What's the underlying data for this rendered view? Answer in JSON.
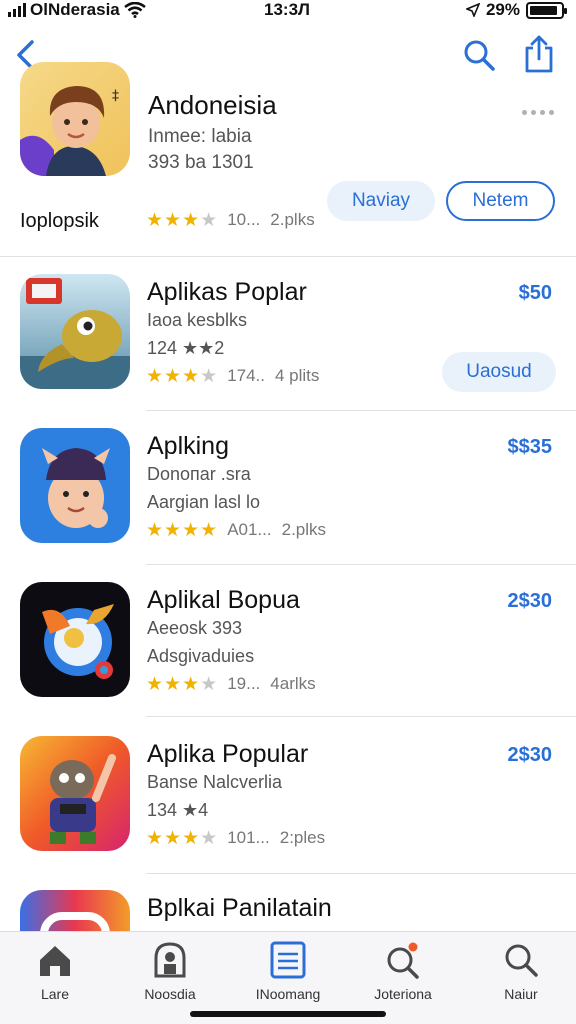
{
  "status": {
    "carrier": "OlNderasia",
    "time": "13:3Л",
    "battery": "29%",
    "battery_level": 0.9
  },
  "hero": {
    "title": "Andoneisia",
    "subtitle1": "Inmee: labia",
    "subtitle2": "393 ba 1301",
    "tag": "Ioplopsik",
    "stars": 3,
    "count": "10...",
    "extra": "2.plks",
    "primary_button": "Naviay",
    "secondary_button": "Netem"
  },
  "apps": [
    {
      "name": "Aplikas Poplar",
      "line1": "Iaoa kesblks",
      "line2": "124 ★★2",
      "stars": 3,
      "count": "174..",
      "extra": "4 plits",
      "price": "$50",
      "button": "Uaosud"
    },
    {
      "name": "Aplking",
      "line1": "Donoпar .sra",
      "line2": "Aargian lasl lo",
      "stars": 3.5,
      "count": "A01...",
      "extra": "2.plks",
      "price": "$$35",
      "button": ""
    },
    {
      "name": "Aplikal Bopua",
      "line1": "Aeeosk 393",
      "line2": "Adsgivaduies",
      "stars": 3,
      "count": "19...",
      "extra": "4arlks",
      "price": "2$30",
      "button": ""
    },
    {
      "name": "Aplika Popular",
      "line1": "Banse Nalcverlia",
      "line2": "134 ★4",
      "stars": 3,
      "count": "101...",
      "extra": "2:ples",
      "price": "2$30",
      "button": ""
    }
  ],
  "partial_app": {
    "name": "Bplkai Panilatain"
  },
  "tabs": [
    {
      "label": "Lare",
      "icon": "home-icon"
    },
    {
      "label": "Noosdia",
      "icon": "arcade-icon"
    },
    {
      "label": "INoomang",
      "icon": "list-icon"
    },
    {
      "label": "Joteriona",
      "icon": "search-badge-icon"
    },
    {
      "label": "Naiur",
      "icon": "search-icon"
    }
  ],
  "colors": {
    "accent": "#2a6fd6",
    "star": "#f0b400",
    "badge": "#f05a28"
  }
}
